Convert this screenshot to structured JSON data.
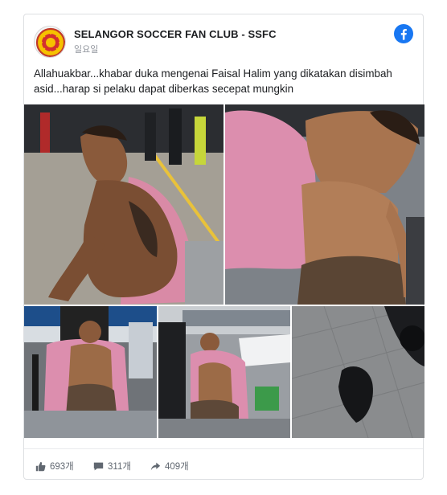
{
  "post": {
    "page_name": "SELANGOR SOCCER FAN CLUB - SSFC",
    "time": "일요일",
    "text": "Allahuakbar...khabar duka mengenai Faisal Halim yang dikatakan disimbah asid...harap si pelaku dapat diberkas secepat mungkin",
    "icons": {
      "avatar": "club-crest-icon",
      "platform": "facebook-icon"
    },
    "colors": {
      "facebook_blue": "#1877f2",
      "muted": "#606770"
    }
  },
  "photos": [
    {
      "name": "photo-1",
      "alt": "Man with burns on back, towel on shoulders, seated outdoors"
    },
    {
      "name": "photo-2",
      "alt": "Shirtless man seated with pink towel"
    },
    {
      "name": "photo-3",
      "alt": "Man with pink towel sitting on bench with people around"
    },
    {
      "name": "photo-4",
      "alt": "Man with pink towel sitting near cars"
    },
    {
      "name": "photo-5",
      "alt": "Black garment lying on pavement"
    }
  ],
  "stats": {
    "likes": "693개",
    "comments": "311개",
    "shares": "409개"
  }
}
